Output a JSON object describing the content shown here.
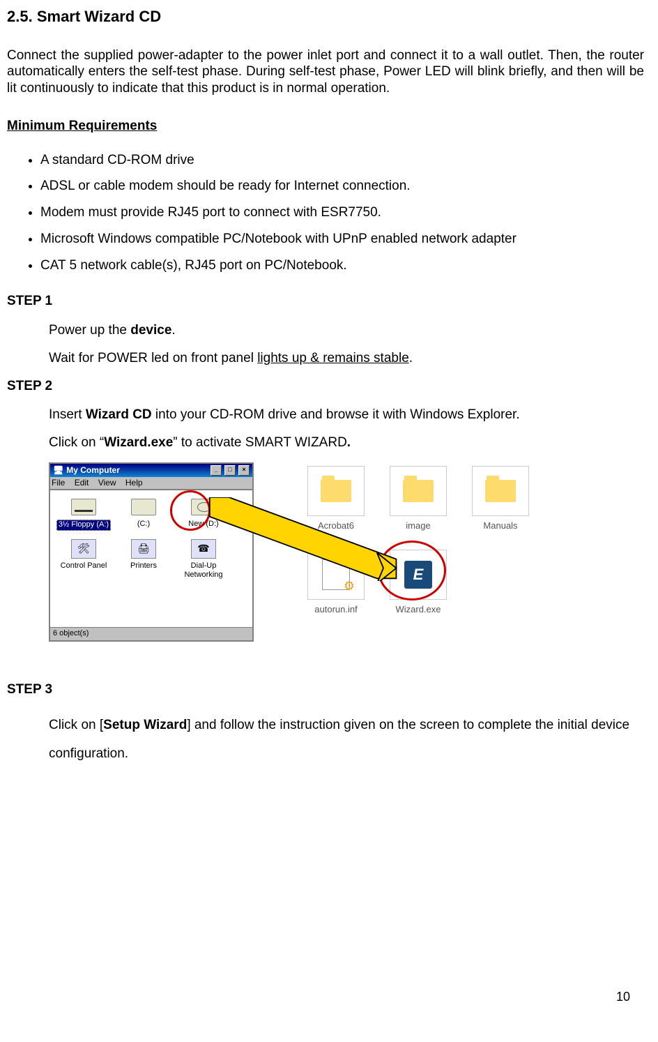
{
  "section": {
    "number": "2.5.",
    "title": "Smart Wizard CD"
  },
  "intro": "Connect the supplied power-adapter to the power inlet port and connect it to a wall outlet. Then, the router automatically enters the self-test phase. During self-test phase, Power LED will blink briefly, and then will be lit continuously to indicate that this product is in normal operation.",
  "min_req_title": "Minimum Requirements",
  "requirements": [
    "A standard CD-ROM drive",
    "ADSL or cable modem should be ready for Internet connection.",
    "Modem must provide RJ45 port to connect with ESR7750.",
    "Microsoft Windows compatible PC/Notebook with UPnP enabled network adapter",
    "CAT 5 network cable(s), RJ45 port on PC/Notebook."
  ],
  "steps": {
    "s1_label": "STEP 1",
    "s1_line1_a": "Power up the ",
    "s1_line1_b": "device",
    "s1_line1_c": ".",
    "s1_line2_a": "Wait for POWER led on front panel ",
    "s1_line2_u": "lights up & remains stable",
    "s1_line2_c": ".",
    "s2_label": "STEP 2",
    "s2_line1_a": "Insert ",
    "s2_line1_b": "Wizard CD",
    "s2_line1_c": " into your CD-ROM drive and browse it with Windows Explorer.",
    "s2_line2_a": "Click on “",
    "s2_line2_b": "Wizard.exe",
    "s2_line2_c": "” to activate SMART WIZARD",
    "s2_line2_d": ".",
    "s3_label": "STEP 3",
    "s3_line_a": "Click on [",
    "s3_line_b": "Setup Wizard",
    "s3_line_c": "] and follow the instruction given on the screen to complete the initial device configuration."
  },
  "explorer": {
    "title": "My Computer",
    "menu": {
      "file": "File",
      "edit": "Edit",
      "view": "View",
      "help": "Help"
    },
    "icons": {
      "floppy": "3½ Floppy (A:)",
      "c": "(C:)",
      "d": "New (D:)",
      "cp": "Control Panel",
      "pr": "Printers",
      "dun": "Dial-Up Networking"
    },
    "status": "6 object(s)",
    "sysbtn": {
      "min": "_",
      "max": "□",
      "close": "×"
    }
  },
  "cd": {
    "acrobat": "Acrobat6",
    "image": "image",
    "manuals": "Manuals",
    "autorun": "autorun.inf",
    "wizard": "Wizard.exe",
    "app_glyph": "E"
  },
  "page_number": "10"
}
